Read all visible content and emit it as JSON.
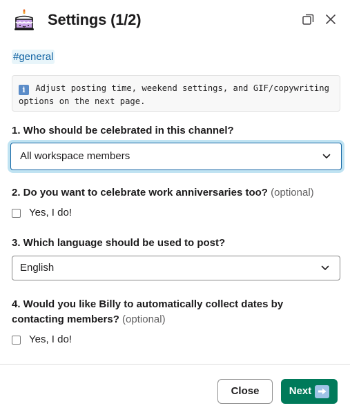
{
  "header": {
    "title": "Settings (1/2)",
    "app_icon": "birthday-cake-icon",
    "expand_icon": "expand-window-icon",
    "close_icon": "close-icon"
  },
  "channel": {
    "tag": "#general"
  },
  "info": {
    "icon": "info-icon",
    "icon_glyph": "i",
    "text": "Adjust posting time, weekend settings, and GIF/copywriting options on the next page."
  },
  "questions": {
    "q1": {
      "label": "1. Who should be celebrated in this channel?",
      "selected": "All workspace members"
    },
    "q2": {
      "label": "2. Do you want to celebrate work anniversaries too?",
      "optional": "(optional)",
      "checkbox_label": "Yes, I do!",
      "checked": false
    },
    "q3": {
      "label": "3. Which language should be used to post?",
      "selected": "English"
    },
    "q4": {
      "label": "4. Would you like Billy to automatically collect dates by contacting members?",
      "optional": "(optional)",
      "checkbox_label": "Yes, I do!",
      "checked": false
    }
  },
  "footer": {
    "close_label": "Close",
    "next_label": "Next",
    "next_icon": "right-arrow-icon"
  },
  "colors": {
    "accent": "#1264a3",
    "primary_button": "#007a5a",
    "focus_ring": "#1d9bd1"
  }
}
